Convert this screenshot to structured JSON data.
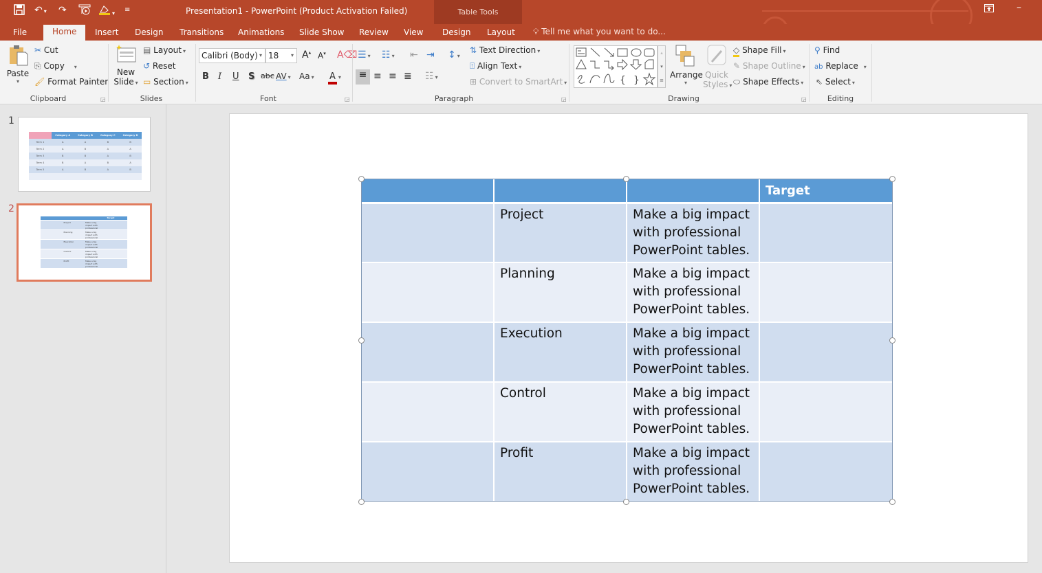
{
  "window": {
    "title": "Presentation1 - PowerPoint (Product Activation Failed)",
    "contextual_tab_group": "Table Tools",
    "controls": {
      "ribbon_display": "ribbon-display-options-icon",
      "minimize": "minimize-icon"
    }
  },
  "quick_access": {
    "items": [
      "save-icon",
      "undo-icon",
      "redo-icon",
      "start-from-beginning-icon",
      "touch-mouse-mode-icon",
      "customize-qat-icon"
    ]
  },
  "tabs": [
    {
      "label": "File",
      "active": false
    },
    {
      "label": "Home",
      "active": true
    },
    {
      "label": "Insert",
      "active": false
    },
    {
      "label": "Design",
      "active": false
    },
    {
      "label": "Transitions",
      "active": false
    },
    {
      "label": "Animations",
      "active": false
    },
    {
      "label": "Slide Show",
      "active": false
    },
    {
      "label": "Review",
      "active": false
    },
    {
      "label": "View",
      "active": false
    },
    {
      "label": "Design",
      "active": false,
      "contextual": true
    },
    {
      "label": "Layout",
      "active": false,
      "contextual": true
    }
  ],
  "tell_me": {
    "placeholder": "Tell me what you want to do..."
  },
  "ribbon": {
    "clipboard": {
      "group_label": "Clipboard",
      "paste": "Paste",
      "cut": "Cut",
      "copy": "Copy",
      "format_painter": "Format Painter"
    },
    "slides": {
      "group_label": "Slides",
      "new_slide_line1": "New",
      "new_slide_line2": "Slide",
      "layout": "Layout",
      "reset": "Reset",
      "section": "Section"
    },
    "font": {
      "group_label": "Font",
      "font_name": "Calibri (Body)",
      "font_size": "18",
      "bold": "B",
      "italic": "I",
      "underline": "U",
      "shadow": "S",
      "strikethrough": "abc",
      "char_spacing": "AV",
      "change_case": "Aa",
      "font_color": "A",
      "font_color_hex": "#c00000"
    },
    "paragraph": {
      "group_label": "Paragraph",
      "text_direction": "Text Direction",
      "align_text": "Align Text",
      "convert_smartart": "Convert to SmartArt"
    },
    "drawing": {
      "group_label": "Drawing",
      "arrange": "Arrange",
      "quick_styles_line1": "Quick",
      "quick_styles_line2": "Styles",
      "shape_fill": "Shape Fill",
      "shape_outline": "Shape Outline",
      "shape_effects": "Shape Effects"
    },
    "editing": {
      "group_label": "Editing",
      "find": "Find",
      "replace": "Replace",
      "select": "Select"
    }
  },
  "thumbnails": [
    {
      "number": "1",
      "selected": false,
      "headers": [
        "",
        "Category A",
        "Category B",
        "Category C",
        "Category D"
      ],
      "rows": [
        [
          "Term 1",
          "A",
          "A",
          "B",
          "B"
        ],
        [
          "Term 2",
          "A",
          "B",
          "A",
          "A"
        ],
        [
          "Term 3",
          "B",
          "B",
          "A",
          "B"
        ],
        [
          "Term 4",
          "B",
          "A",
          "B",
          "A"
        ],
        [
          "Term 5",
          "A",
          "B",
          "A",
          "B"
        ]
      ]
    },
    {
      "number": "2",
      "selected": true
    }
  ],
  "slide_table": {
    "headers": [
      "",
      "",
      "",
      "Target"
    ],
    "rows": [
      [
        "",
        "Project",
        "Make a big impact with professional PowerPoint tables.",
        ""
      ],
      [
        "",
        "Planning",
        "Make a big impact with professional PowerPoint tables.",
        ""
      ],
      [
        "",
        "Execution",
        "Make a big impact with professional PowerPoint tables.",
        ""
      ],
      [
        "",
        "Control",
        "Make a big impact with professional PowerPoint tables.",
        ""
      ],
      [
        "",
        "Profit",
        "Make a big impact with professional PowerPoint tables.",
        ""
      ]
    ]
  },
  "colors": {
    "accent": "#b7472a",
    "table_header": "#5b9bd5",
    "table_row_odd": "#d0ddef",
    "table_row_even": "#e9eef7",
    "thumb_selected_border": "#e07b5d"
  }
}
